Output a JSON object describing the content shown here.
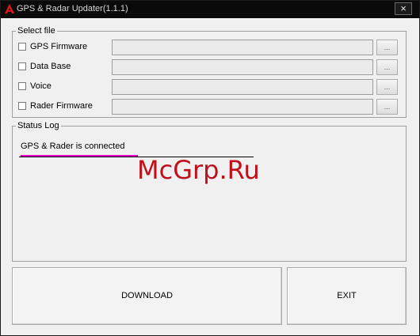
{
  "window": {
    "title": "GPS & Radar Updater(1.1.1)",
    "close_label": "×"
  },
  "select_file": {
    "label": "Select file",
    "browse_label": "...",
    "rows": [
      {
        "label": "GPS Firmware",
        "checked": false,
        "path": ""
      },
      {
        "label": "Data Base",
        "checked": false,
        "path": ""
      },
      {
        "label": "Voice",
        "checked": false,
        "path": ""
      },
      {
        "label": "Rader Firmware",
        "checked": false,
        "path": ""
      }
    ]
  },
  "status_log": {
    "label": "Status Log",
    "lines": [
      "GPS & Rader is connected"
    ]
  },
  "watermark": "McGrp.Ru",
  "buttons": {
    "download": "DOWNLOAD",
    "exit": "EXIT"
  },
  "colors": {
    "titlebar": "#0a0a0a",
    "highlight": "#e000c8",
    "watermark": "#c0101a"
  },
  "icons": {
    "app": "red-a-logo-icon",
    "close": "close-icon"
  }
}
